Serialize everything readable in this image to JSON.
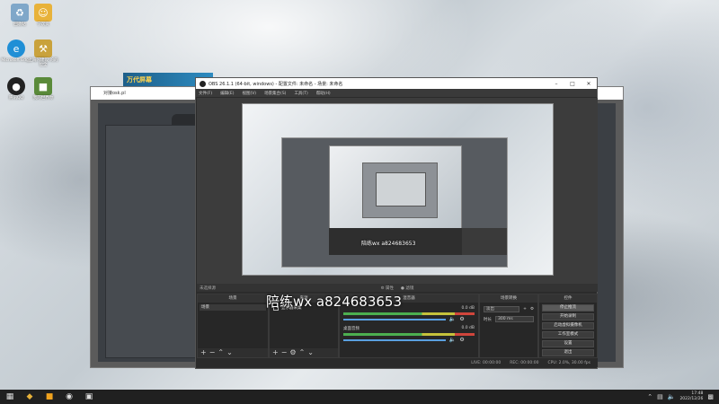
{
  "desktop": {
    "icons": [
      {
        "label": "回收站"
      },
      {
        "label": "宁次资"
      },
      {
        "label": "Microsoft Edge"
      },
      {
        "label": "上海闪建设 的的位全"
      },
      {
        "label": "腾讯QQ"
      },
      {
        "label": "我的世界你"
      }
    ]
  },
  "background_window": {
    "title": "对接osk.pl",
    "banner": "万代屏幕"
  },
  "obs": {
    "title": "OBS 26.1.1 (64-bit, windows) - 配置文件: 未命名 - 场景: 未命名",
    "menu": [
      "文件(F)",
      "编辑(E)",
      "视图(V)",
      "场景集合(S)",
      "工具(T)",
      "帮助(H)"
    ],
    "preview_watermark": "陪练wx a824683653",
    "dock_tabs": {
      "left": "未选择源",
      "props": "属性",
      "filters": "滤镜"
    },
    "scenes": {
      "header": "场景",
      "items": [
        "场景"
      ]
    },
    "sources": {
      "header": "来源",
      "items": [
        "显示器采集"
      ]
    },
    "mixer": {
      "header": "混音器",
      "channels": [
        {
          "name": "",
          "db": "0.0 dB"
        },
        {
          "name": "桌面音频",
          "db": "0.0 dB"
        }
      ]
    },
    "transitions": {
      "header": "场景转换",
      "type": "淡出",
      "duration_label": "时长",
      "duration": "300 ms"
    },
    "controls": {
      "header": "控件",
      "buttons": [
        "停止推流",
        "开始录制",
        "启动虚拟摄像机",
        "工作室模式",
        "设置",
        "退出"
      ]
    },
    "status": {
      "live": "LIVE: 00:00:00",
      "rec": "REC: 00:00:00",
      "cpu": "CPU: 2.0%, 30.00 fps"
    }
  },
  "watermark": "陪练wx a824683653",
  "taskbar": {
    "time": "17:48",
    "date": "2022/12/26"
  }
}
